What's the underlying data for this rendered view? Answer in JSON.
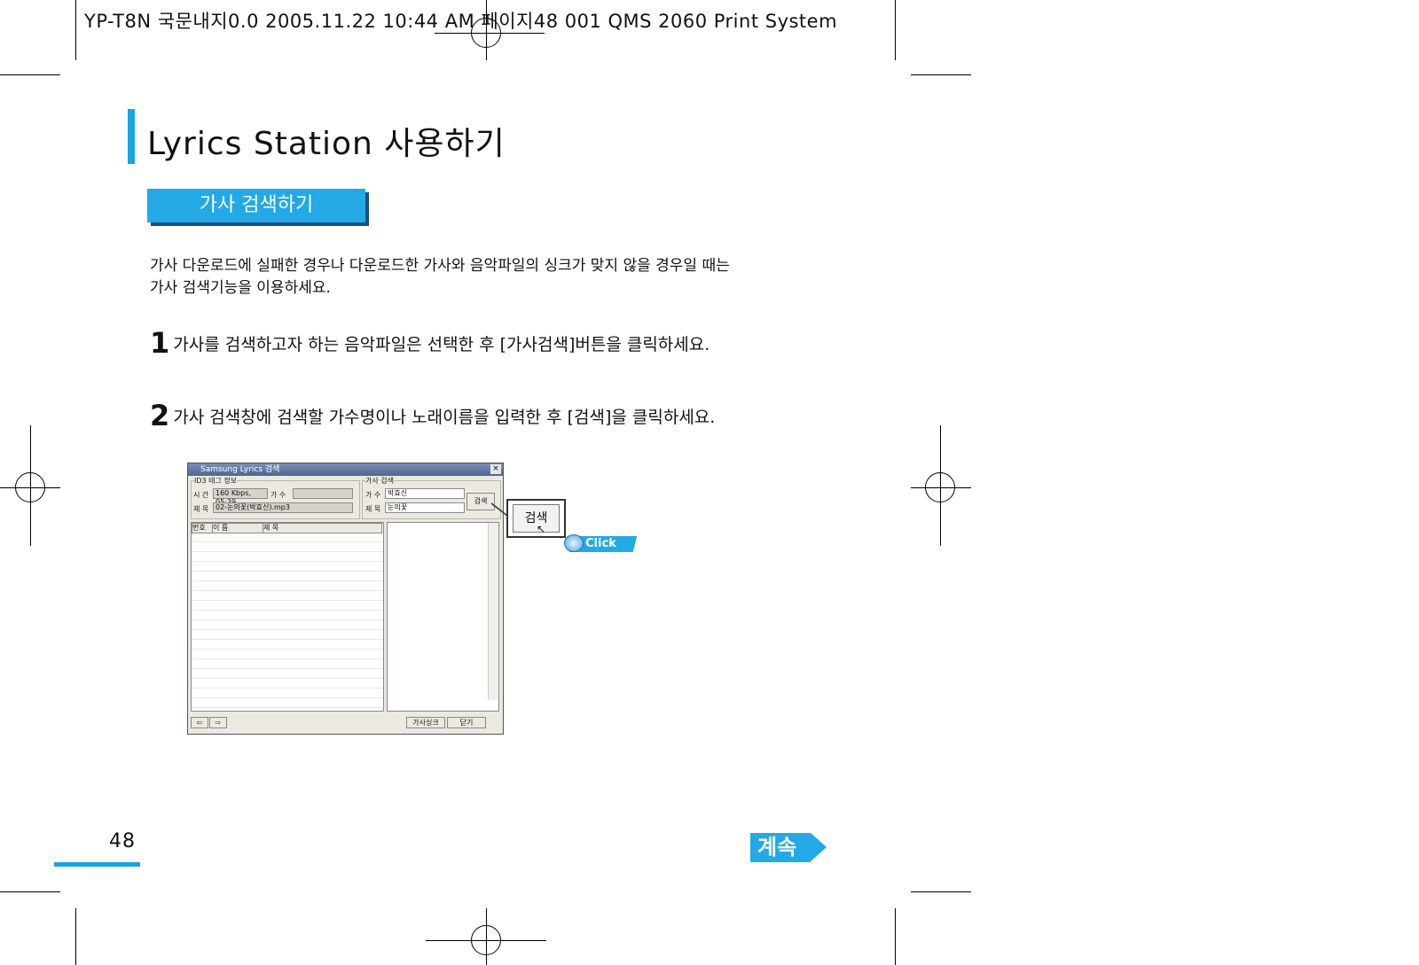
{
  "print_header": "YP-T8N 국문내지0.0  2005.11.22 10:44 AM  페이지48   001 QMS 2060 Print System",
  "title": "Lyrics Station 사용하기",
  "section_label": "가사 검색하기",
  "intro": [
    "가사 다운로드에 실패한 경우나 다운로드한 가사와 음악파일의 싱크가 맞지 않을 경우일 때는",
    "가사 검색기능을 이용하세요."
  ],
  "steps": [
    {
      "num": "1",
      "text": "가사를 검색하고자 하는 음악파일은 선택한 후 [가사검색]버튼을 클릭하세요."
    },
    {
      "num": "2",
      "text": "가사 검색창에 검색할 가수명이나 노래이름을 입력한 후 [검색]을 클릭하세요."
    }
  ],
  "dialog": {
    "window_title": "Samsung Lyrics 검색",
    "close_glyph": "×",
    "id3_group": "ID3 태그 정보",
    "time_label": "시 간",
    "time_value": "160 Kbps, 05:39",
    "artist_label": "가 수",
    "title_label": "제 목",
    "title_value": "02-눈의꽃(박효신).mp3",
    "search_group": "가사 검색",
    "search_artist_label": "가 수",
    "search_artist_value": "박효신",
    "search_title_label": "제 목",
    "search_title_value": "눈의꽃",
    "search_button": "검색",
    "col_no": "번호",
    "col_name": "이 름",
    "col_title": "제 목",
    "nav_prev": "⇦",
    "nav_next": "⇨",
    "sync_button": "가사싱크",
    "close_button": "닫기"
  },
  "callout_button": "검색",
  "click_label": "Click",
  "page_number": "48",
  "continue_label": "계속",
  "accent_color": "#22a9e6"
}
